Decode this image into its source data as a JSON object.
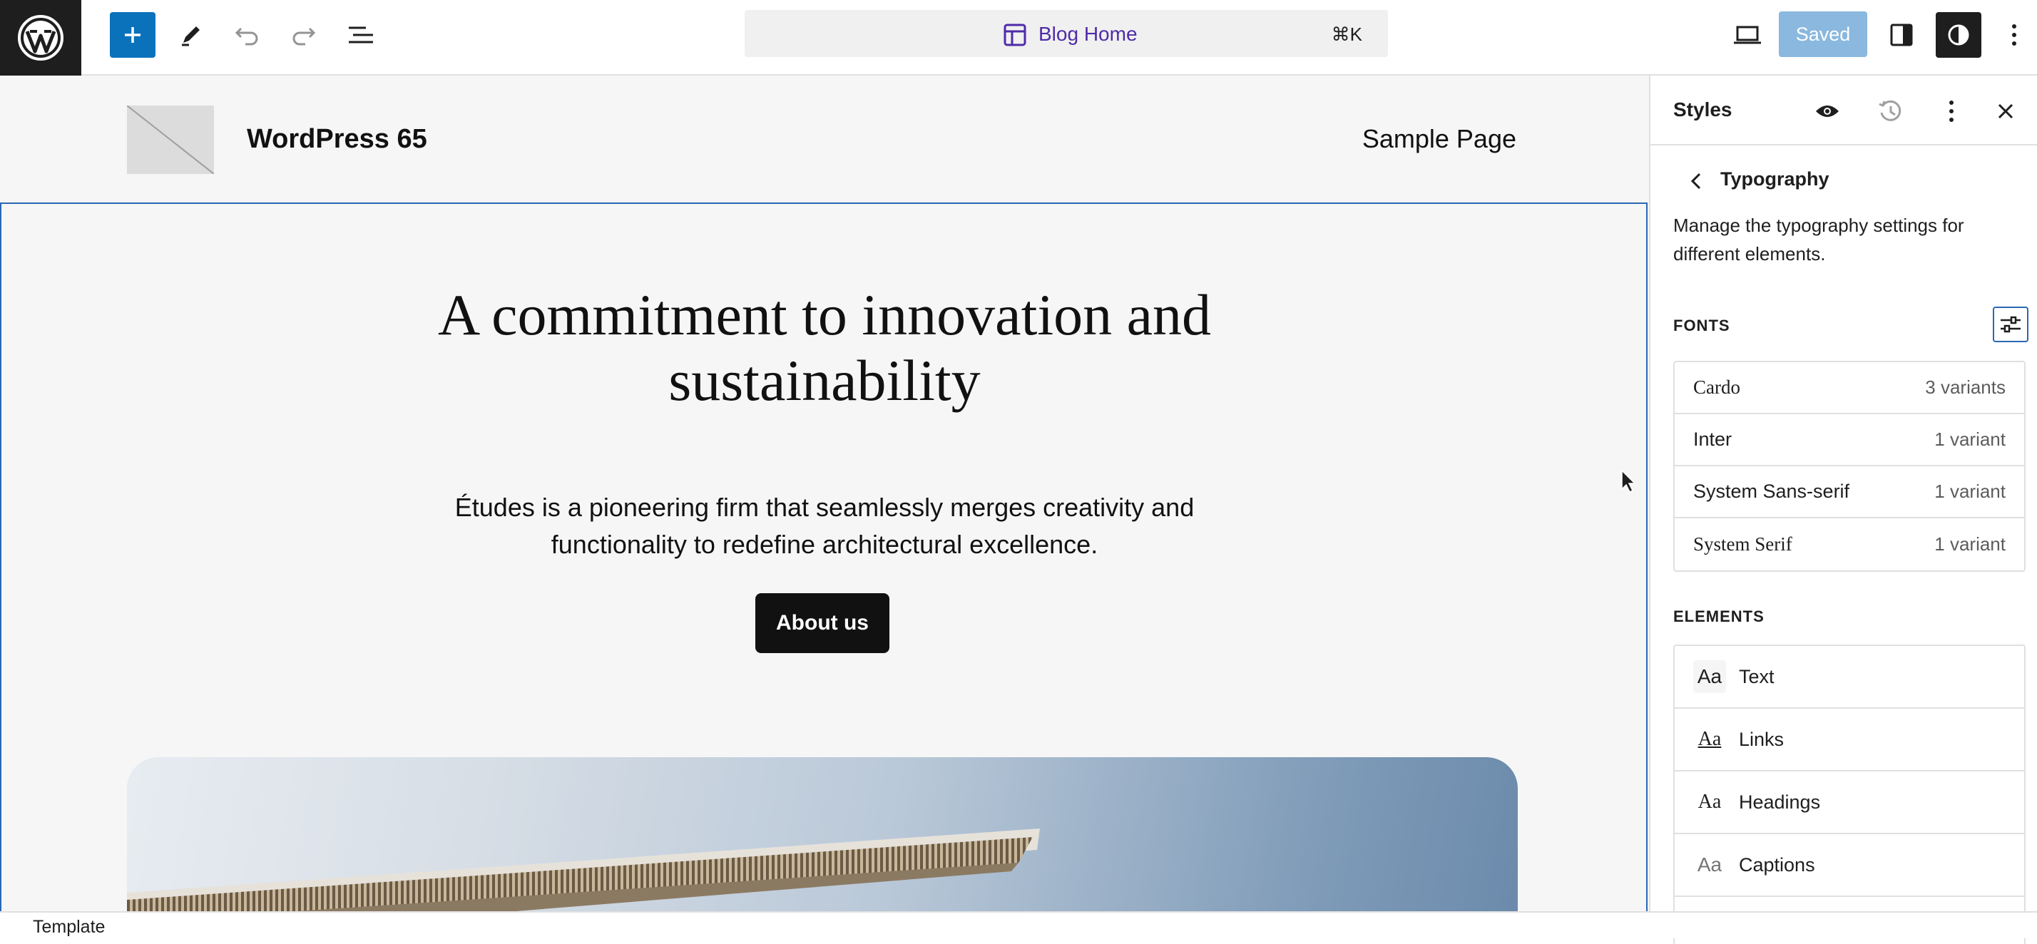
{
  "toolbar": {
    "document_title": "Blog Home",
    "shortcut": "⌘K",
    "saved_label": "Saved"
  },
  "site": {
    "title": "WordPress 65",
    "nav": [
      "Sample Page"
    ]
  },
  "hero": {
    "heading": "A commitment to innovation and sustainability",
    "text": "Études is a pioneering firm that seamlessly merges creativity and functionality to redefine architectural excellence.",
    "button": "About us"
  },
  "panel": {
    "title": "Styles",
    "section": "Typography",
    "description": "Manage the typography settings for different elements.",
    "fonts_label": "FONTS",
    "fonts": [
      {
        "name": "Cardo",
        "variants": "3 variants"
      },
      {
        "name": "Inter",
        "variants": "1 variant"
      },
      {
        "name": "System Sans-serif",
        "variants": "1 variant"
      },
      {
        "name": "System Serif",
        "variants": "1 variant"
      }
    ],
    "elements_label": "ELEMENTS",
    "elements": [
      {
        "aa": "Aa",
        "label": "Text"
      },
      {
        "aa": "Aa",
        "label": "Links"
      },
      {
        "aa": "Aa",
        "label": "Headings"
      },
      {
        "aa": "Aa",
        "label": "Captions"
      }
    ]
  },
  "footer": {
    "breadcrumb": "Template"
  },
  "colors": {
    "accent": "#0a72bb",
    "doc_title": "#4f2ba8",
    "focus": "#2a67b3"
  }
}
